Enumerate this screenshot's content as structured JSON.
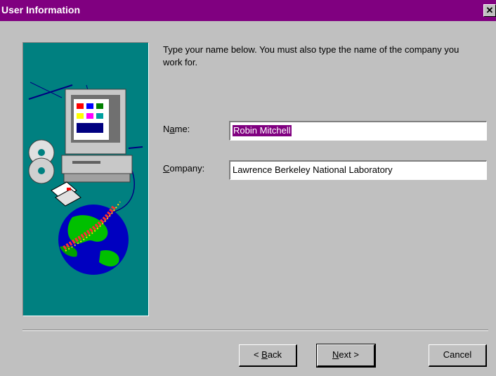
{
  "window": {
    "title": "User Information",
    "close_glyph": "✕"
  },
  "instructions": "Type your name below. You must also type the name of the company you work for.",
  "name_field": {
    "label_before": "N",
    "label_accel": "a",
    "label_after": "me:",
    "value": "Robin Mitchell"
  },
  "company_field": {
    "label_accel": "C",
    "label_after": "ompany:",
    "value": "Lawrence Berkeley National Laboratory"
  },
  "buttons": {
    "back": {
      "prefix": "< ",
      "accel": "B",
      "rest": "ack"
    },
    "next": {
      "accel": "N",
      "rest": "ext >"
    },
    "cancel": {
      "label": "Cancel"
    }
  },
  "illustration": {
    "icons": [
      "computer-icon",
      "cd-icon",
      "floppy-icon",
      "globe-icon"
    ],
    "background": "#008080"
  }
}
